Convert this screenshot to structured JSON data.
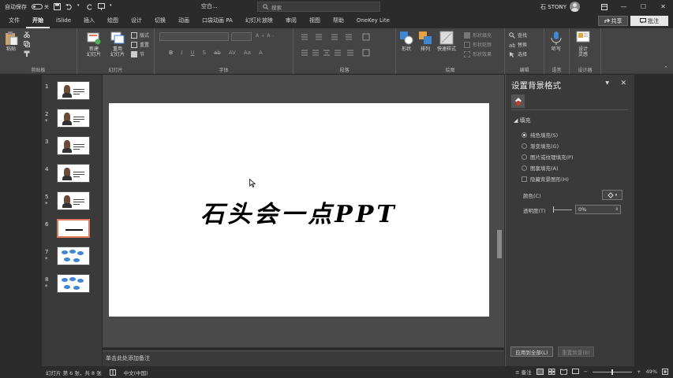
{
  "titlebar": {
    "autosave_label": "自动保存",
    "autosave_state": "关",
    "doc_title": "空白...",
    "search_placeholder": "搜索",
    "user_name": "石 STONY"
  },
  "tabs": [
    "文件",
    "开始",
    "iSlide",
    "插入",
    "绘图",
    "设计",
    "切换",
    "动画",
    "口袋动画 PA",
    "幻灯片放映",
    "审阅",
    "视图",
    "帮助",
    "OneKey Lite"
  ],
  "active_tab": "开始",
  "share_label": "共享",
  "comment_label": "批注",
  "ribbon": {
    "clipboard": {
      "label": "剪贴板",
      "paste": "粘贴"
    },
    "slides": {
      "label": "幻灯片",
      "new_slide": "新建\n幻灯片",
      "reuse": "重用\n幻灯片",
      "layout": "版式",
      "reset": "重置",
      "section": "节"
    },
    "font": {
      "label": "字体"
    },
    "paragraph": {
      "label": "段落"
    },
    "drawing": {
      "label": "绘图",
      "shapes": "形状",
      "arrange": "排列",
      "quick_styles": "快速样式",
      "fill": "形状填充",
      "outline": "形状轮廓",
      "effects": "形状效果"
    },
    "editing": {
      "label": "编辑",
      "find": "查找",
      "replace": "替换",
      "select": "选择"
    },
    "voice": {
      "label": "语音",
      "dictate": "听写"
    },
    "designer": {
      "label": "设计器",
      "ideas": "设计\n灵感"
    }
  },
  "thumbnails": [
    {
      "num": "1",
      "star": "",
      "type": "face"
    },
    {
      "num": "2",
      "star": "*",
      "type": "face"
    },
    {
      "num": "3",
      "star": "",
      "type": "face"
    },
    {
      "num": "4",
      "star": "",
      "type": "face"
    },
    {
      "num": "5",
      "star": "*",
      "type": "face"
    },
    {
      "num": "6",
      "star": "",
      "type": "title"
    },
    {
      "num": "7",
      "star": "*",
      "type": "diagram"
    },
    {
      "num": "8",
      "star": "*",
      "type": "diagram"
    }
  ],
  "selected_slide": 6,
  "slide": {
    "title": "石头会一点PPT"
  },
  "notes_placeholder": "单击此处添加备注",
  "pane": {
    "title": "设置背景格式",
    "section": "填充",
    "options": [
      {
        "label": "纯色填充(S)",
        "type": "radio",
        "checked": true
      },
      {
        "label": "渐变填充(G)",
        "type": "radio",
        "checked": false
      },
      {
        "label": "图片或纹理填充(P)",
        "type": "radio",
        "checked": false
      },
      {
        "label": "图案填充(A)",
        "type": "radio",
        "checked": false
      },
      {
        "label": "隐藏背景图形(H)",
        "type": "checkbox",
        "checked": false
      }
    ],
    "color_label": "颜色(C)",
    "transparency_label": "透明度(T)",
    "transparency_value": "0%",
    "apply_all": "应用到全部(L)",
    "reset_bg": "重置背景(B)"
  },
  "status": {
    "slide_info": "幻灯片 第 6 张，共 8 张",
    "language": "中文(中国)",
    "notes": "备注",
    "zoom": "49%"
  },
  "colors": {
    "accent": "#e07a5f",
    "fill_icon": "#c0392b",
    "diagram_blue": "#3f86d6"
  }
}
